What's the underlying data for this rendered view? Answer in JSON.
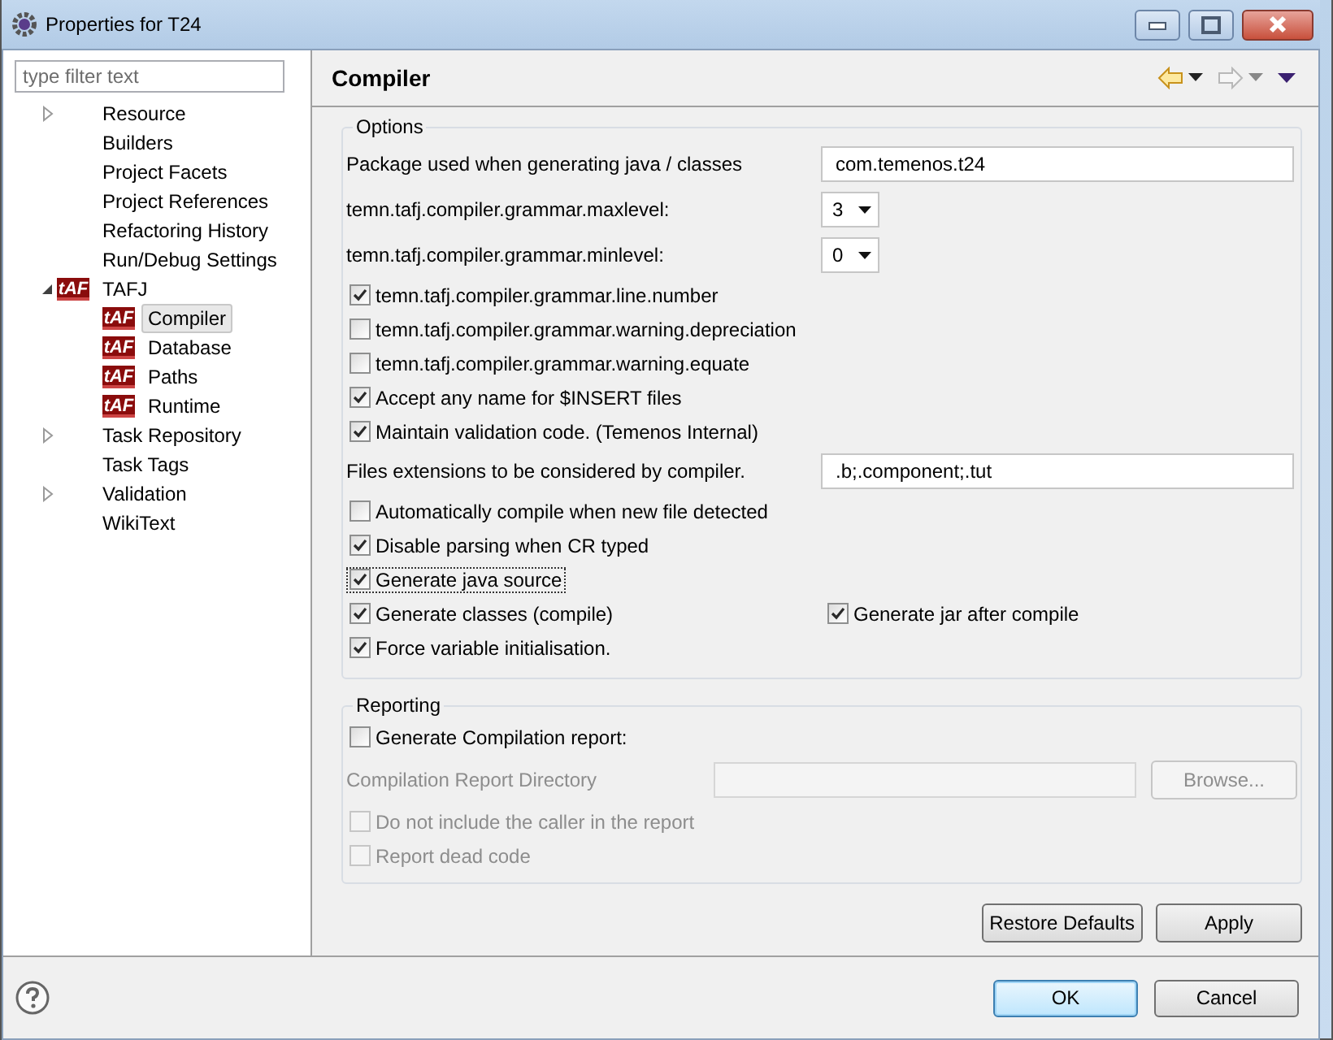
{
  "window": {
    "title": "Properties for T24"
  },
  "filter": {
    "placeholder": "type filter text"
  },
  "tree": [
    {
      "label": "Resource",
      "expanded": false,
      "selected": false
    },
    {
      "label": "Builders",
      "selected": false
    },
    {
      "label": "Project Facets",
      "selected": false
    },
    {
      "label": "Project References",
      "selected": false
    },
    {
      "label": "Refactoring History",
      "selected": false
    },
    {
      "label": "Run/Debug Settings",
      "selected": false
    },
    {
      "label": "TAFJ",
      "expanded": true,
      "badge": "tAF",
      "selected": false,
      "children": [
        {
          "label": "Compiler",
          "badge": "tAF",
          "selected": true
        },
        {
          "label": "Database",
          "badge": "tAF",
          "selected": false
        },
        {
          "label": "Paths",
          "badge": "tAF",
          "selected": false
        },
        {
          "label": "Runtime",
          "badge": "tAF",
          "selected": false
        }
      ]
    },
    {
      "label": "Task Repository",
      "expanded": false,
      "selected": false
    },
    {
      "label": "Task Tags",
      "selected": false
    },
    {
      "label": "Validation",
      "expanded": false,
      "selected": false
    },
    {
      "label": "WikiText",
      "selected": false
    }
  ],
  "page": {
    "title": "Compiler"
  },
  "options": {
    "title": "Options",
    "rows": [
      {
        "kind": "text",
        "label": "Package used when generating java / classes",
        "value": "com.temenos.t24"
      },
      {
        "kind": "combo",
        "label": "temn.tafj.compiler.grammar.maxlevel:",
        "value": "3"
      },
      {
        "kind": "combo",
        "label": "temn.tafj.compiler.grammar.minlevel:",
        "value": "0"
      },
      {
        "kind": "check",
        "label": "temn.tafj.compiler.grammar.line.number",
        "checked": true
      },
      {
        "kind": "check",
        "label": "temn.tafj.compiler.grammar.warning.depreciation",
        "checked": false
      },
      {
        "kind": "check",
        "label": "temn.tafj.compiler.grammar.warning.equate",
        "checked": false
      },
      {
        "kind": "check",
        "label": "Accept any name for $INSERT files",
        "checked": true
      },
      {
        "kind": "check",
        "label": "Maintain validation code. (Temenos Internal)",
        "checked": true
      },
      {
        "kind": "text",
        "label": "Files extensions to be considered by compiler.",
        "value": ".b;.component;.tut"
      },
      {
        "kind": "check",
        "label": "Automatically compile when new file detected",
        "checked": false
      },
      {
        "kind": "check",
        "label": "Disable parsing when CR typed",
        "checked": true
      },
      {
        "kind": "check",
        "label": "Generate java source",
        "checked": true,
        "focused": true
      },
      {
        "kind": "pair",
        "items": [
          {
            "label": "Generate classes (compile)",
            "checked": true
          },
          {
            "label": "Generate jar after compile",
            "checked": true
          }
        ]
      },
      {
        "kind": "check",
        "label": "Force variable initialisation.",
        "checked": true
      }
    ]
  },
  "reporting": {
    "title": "Reporting",
    "rows": [
      {
        "kind": "check",
        "label": "Generate Compilation report:",
        "checked": false,
        "disabled": false
      },
      {
        "kind": "path",
        "label": "Compilation Report Directory",
        "button": "Browse...",
        "disabled": true
      },
      {
        "kind": "check",
        "label": "Do not include the caller in the report",
        "checked": false,
        "disabled": true
      },
      {
        "kind": "check",
        "label": "Report dead code",
        "checked": false,
        "disabled": true
      }
    ]
  },
  "page_buttons": [
    "Restore Defaults",
    "Apply"
  ],
  "dialog_buttons": [
    {
      "label": "OK",
      "default": true
    },
    {
      "label": "Cancel",
      "default": false
    }
  ]
}
